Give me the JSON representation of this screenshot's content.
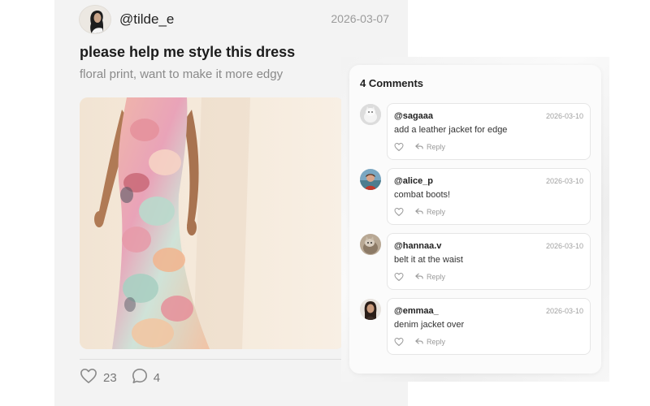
{
  "post": {
    "username": "@tilde_e",
    "date": "2026-03-07",
    "title": "please help me style this dress",
    "subtitle": "floral print, want to make it more edgy",
    "likes": "23",
    "comments_count": "4"
  },
  "comments_panel": {
    "title": "4 Comments",
    "items": [
      {
        "user": "@sagaaa",
        "date": "2026-03-10",
        "text": "add a leather jacket for edge",
        "reply_label": "Reply"
      },
      {
        "user": "@alice_p",
        "date": "2026-03-10",
        "text": "combat boots!",
        "reply_label": "Reply"
      },
      {
        "user": "@hannaa.v",
        "date": "2026-03-10",
        "text": "belt it at the waist",
        "reply_label": "Reply"
      },
      {
        "user": "@emmaa_",
        "date": "2026-03-10",
        "text": "denim jacket over",
        "reply_label": "Reply"
      }
    ]
  },
  "icons": {
    "like": "heart-icon",
    "comment": "speech-bubble-icon",
    "reply": "reply-arrow-icon"
  }
}
